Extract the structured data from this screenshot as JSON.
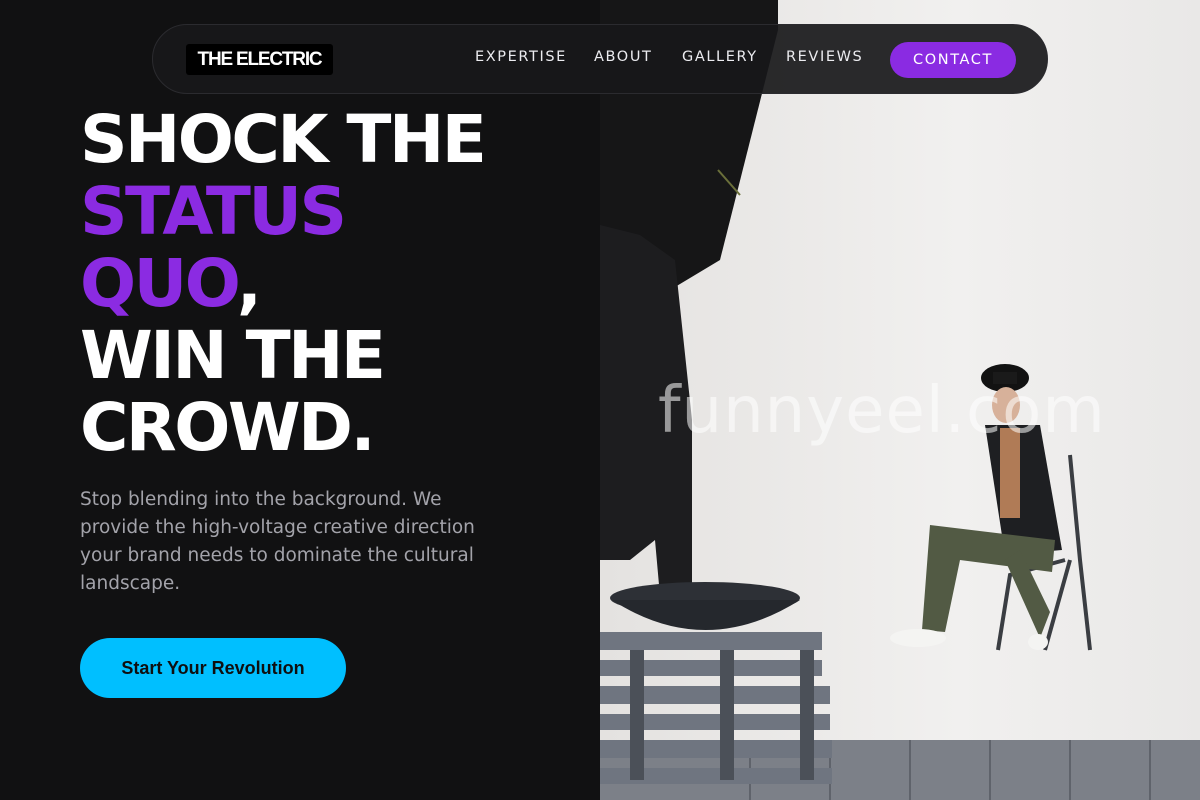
{
  "nav": {
    "logo": "THE ELECTRIC",
    "links": [
      "EXPERTISE",
      "ABOUT",
      "GALLERY",
      "REVIEWS"
    ],
    "contact": "CONTACT"
  },
  "hero": {
    "line1": "SHOCK THE",
    "line2": "STATUS",
    "line3_accent": "QUO",
    "line3_rest": ",",
    "line4": "WIN THE",
    "line5": "CROWD.",
    "body": "Stop blending into the background. We provide the high-voltage creative direction your brand needs to dominate the cultural landscape.",
    "cta": "Start Your Revolution"
  },
  "photo": {
    "watermark": "funnyeel.com"
  },
  "colors": {
    "background": "#111112",
    "accent_purple": "#8a2be2",
    "cta_blue": "#00bfff",
    "text_white": "#ffffff",
    "text_muted": "#a3a3aa"
  }
}
